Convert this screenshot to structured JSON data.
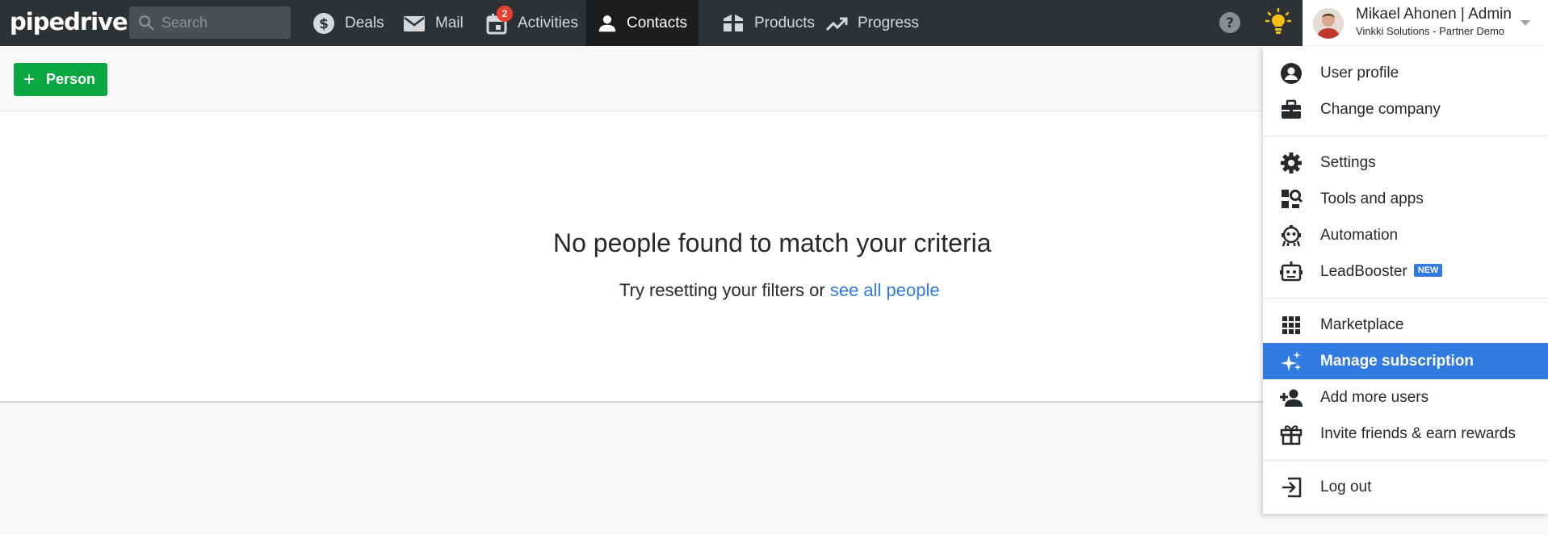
{
  "app": {
    "logo": "pipedrive"
  },
  "search": {
    "placeholder": "Search"
  },
  "nav": {
    "deals": "Deals",
    "mail": "Mail",
    "activities": "Activities",
    "activities_badge": "2",
    "contacts": "Contacts",
    "products": "Products",
    "progress": "Progress"
  },
  "user": {
    "name": "Mikael Ahonen | Admin",
    "company": "Vinkki Solutions - Partner Demo"
  },
  "toolbar": {
    "add_person": "Person"
  },
  "empty_state": {
    "title": "No people found to match your criteria",
    "subtitle": "Try resetting your filters or",
    "link": "see all people"
  },
  "menu": {
    "user_profile": "User profile",
    "change_company": "Change company",
    "settings": "Settings",
    "tools_and_apps": "Tools and apps",
    "automation": "Automation",
    "leadbooster": "LeadBooster",
    "leadbooster_tag": "NEW",
    "marketplace": "Marketplace",
    "manage_subscription": "Manage subscription",
    "add_more_users": "Add more users",
    "invite_friends": "Invite friends & earn rewards",
    "log_out": "Log out"
  },
  "colors": {
    "topbar": "#2f3235",
    "active_nav": "#1b1d1f",
    "accent_green": "#08a742",
    "accent_blue": "#317ae2",
    "badge_red": "#e8412f",
    "bulb_yellow": "#f6c211"
  }
}
